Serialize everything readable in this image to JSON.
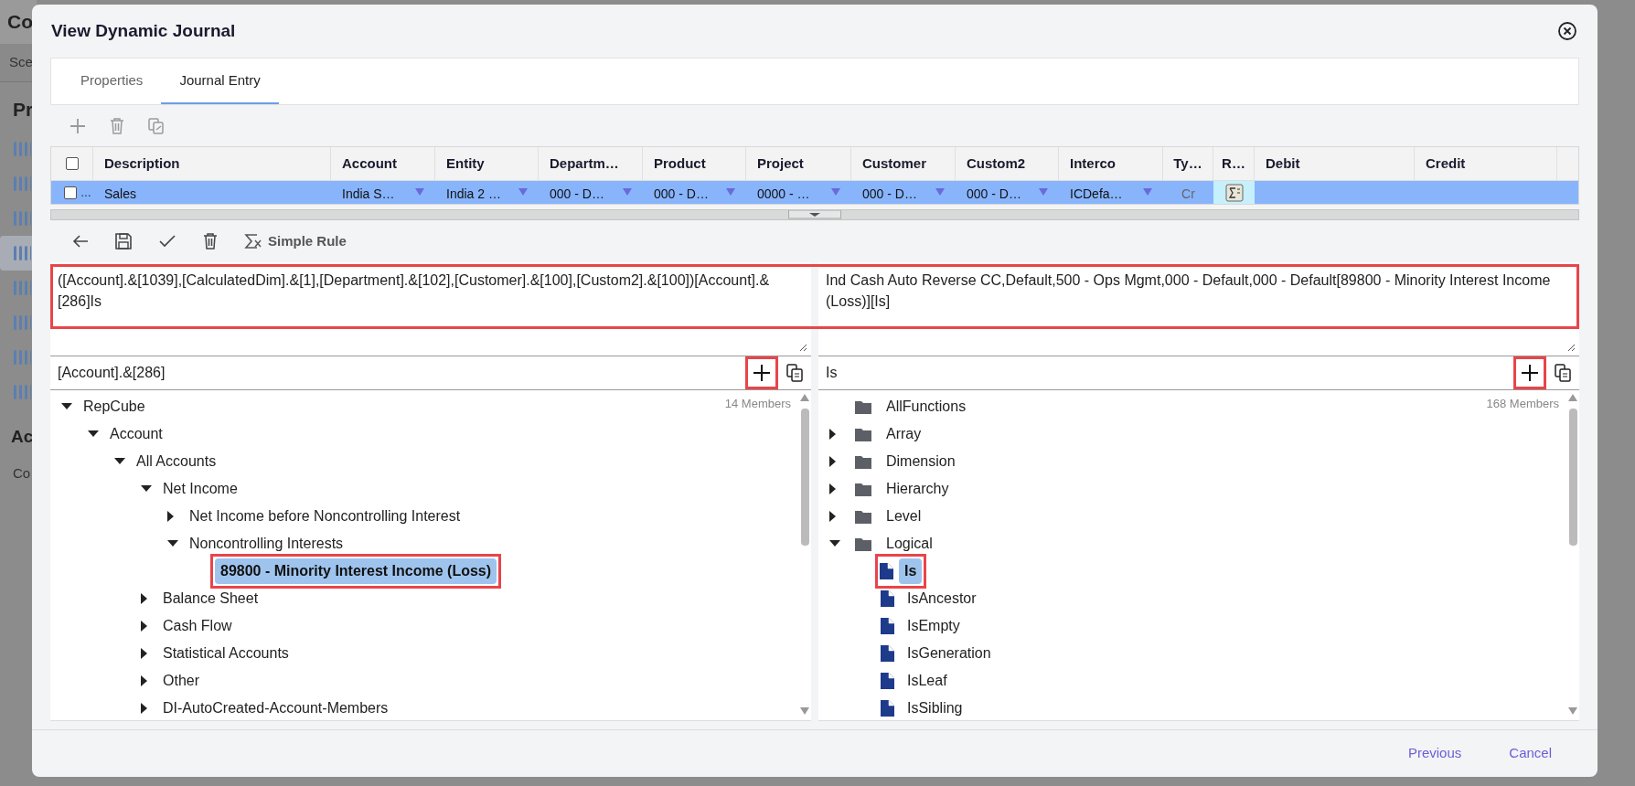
{
  "background": {
    "title": "Co",
    "subtitle": "Sce",
    "section": "Pr",
    "section2": "Ac",
    "link": "Co",
    "rows": [
      {
        "selected": false
      },
      {
        "selected": false
      },
      {
        "selected": false
      },
      {
        "selected": true
      },
      {
        "selected": false
      },
      {
        "selected": false
      },
      {
        "selected": false
      },
      {
        "selected": false
      }
    ]
  },
  "dialog": {
    "title": "View Dynamic Journal",
    "tabs": [
      {
        "label": "Properties",
        "selected": false
      },
      {
        "label": "Journal Entry",
        "selected": true
      }
    ],
    "grid": {
      "all_checked": false,
      "columns": [
        "Description",
        "Account",
        "Entity",
        "Departm…",
        "Product",
        "Project",
        "Customer",
        "Custom2",
        "Interco",
        "Ty…",
        "R…",
        "Debit",
        "Credit"
      ],
      "rows": [
        {
          "selected": true,
          "checked": false,
          "marker": "…",
          "cells": [
            {
              "kind": "text",
              "text": "Sales"
            },
            {
              "kind": "dropdown",
              "text": "India S…"
            },
            {
              "kind": "dropdown",
              "text": "India 2 …"
            },
            {
              "kind": "dropdown",
              "text": "000 - D…"
            },
            {
              "kind": "dropdown",
              "text": "000 - D…"
            },
            {
              "kind": "dropdown",
              "text": "0000 - …"
            },
            {
              "kind": "dropdown",
              "text": "000 - D…"
            },
            {
              "kind": "dropdown",
              "text": "000 - D…"
            },
            {
              "kind": "dropdown",
              "text": "ICDefa…"
            },
            {
              "kind": "muted",
              "text": "Cr"
            },
            {
              "kind": "rule"
            },
            {
              "kind": "empty"
            },
            {
              "kind": "empty"
            }
          ]
        }
      ]
    },
    "rule_toolbar": {
      "simple_rule": "Simple Rule"
    },
    "expression": {
      "left": "([Account].&[1039],[CalculatedDim].&[1],[Department].&[102],[Customer].&[100],[Custom2].&[100])[Account].&[286]Is",
      "right": "Ind Cash Auto Reverse CC,Default,500 - Ops Mgmt,000 - Default,000 - Default[89800 - Minority Interest Income (Loss)][Is]",
      "highlighted": true
    },
    "left_panel": {
      "value": "[Account].&[286]",
      "add_highlighted": true,
      "count": "14 Members",
      "tree": [
        {
          "label": "RepCube",
          "expanded": true,
          "children": [
            {
              "label": "Account",
              "expanded": true,
              "children": [
                {
                  "label": "All Accounts",
                  "expanded": true,
                  "children": [
                    {
                      "label": "Net Income",
                      "expanded": true,
                      "children": [
                        {
                          "label": "Net Income before Noncontrolling Interest",
                          "expanded": false
                        },
                        {
                          "label": "Noncontrolling Interests",
                          "expanded": true,
                          "children": [
                            {
                              "label": "89800 - Minority Interest Income (Loss)",
                              "selected": true,
                              "highlighted": true
                            }
                          ]
                        }
                      ]
                    },
                    {
                      "label": "Balance Sheet",
                      "expanded": false
                    },
                    {
                      "label": "Cash Flow",
                      "expanded": false
                    },
                    {
                      "label": "Statistical Accounts",
                      "expanded": false
                    },
                    {
                      "label": "Other",
                      "expanded": false
                    },
                    {
                      "label": "DI-AutoCreated-Account-Members",
                      "expanded": false
                    }
                  ]
                }
              ]
            }
          ]
        }
      ]
    },
    "right_panel": {
      "value": "Is",
      "add_highlighted": true,
      "count": "168 Members",
      "tree": [
        {
          "label": "AllFunctions",
          "kind": "folder"
        },
        {
          "label": "Array",
          "kind": "folder",
          "expanded": false
        },
        {
          "label": "Dimension",
          "kind": "folder",
          "expanded": false
        },
        {
          "label": "Hierarchy",
          "kind": "folder",
          "expanded": false
        },
        {
          "label": "Level",
          "kind": "folder",
          "expanded": false
        },
        {
          "label": "Logical",
          "kind": "folder",
          "expanded": true,
          "children": [
            {
              "label": "Is",
              "kind": "function",
              "selected": true,
              "highlighted": true
            },
            {
              "label": "IsAncestor",
              "kind": "function",
              "selected": false
            },
            {
              "label": "IsEmpty",
              "kind": "function",
              "selected": false
            },
            {
              "label": "IsGeneration",
              "kind": "function",
              "selected": false
            },
            {
              "label": "IsLeaf",
              "kind": "function",
              "selected": false
            },
            {
              "label": "IsSibling",
              "kind": "function",
              "selected": false
            }
          ]
        }
      ]
    },
    "footer": [
      "Previous",
      "Cancel"
    ]
  }
}
